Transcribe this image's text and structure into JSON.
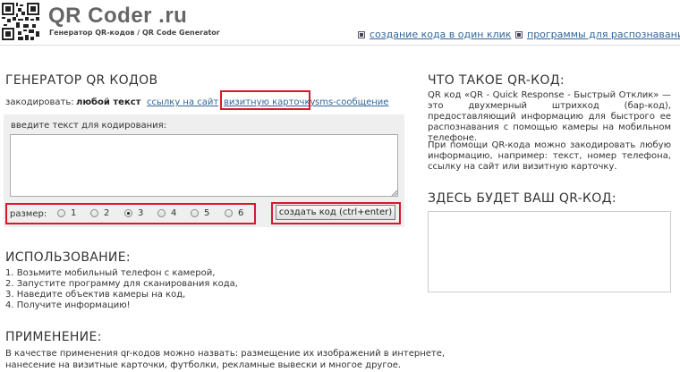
{
  "header": {
    "title": "QR Coder .ru",
    "subtitle": "Генератор QR-кодов / QR Code Generator",
    "links": [
      {
        "label": "создание кода в один клик"
      },
      {
        "label": "программы для распознавания"
      }
    ]
  },
  "generator": {
    "title": "ГЕНЕРАТОР QR КОДОВ",
    "encode_label": "закодировать:",
    "types": [
      {
        "label": "любой текст",
        "active": true
      },
      {
        "label": "ссылку на сайт"
      },
      {
        "label": "визитную карточку"
      },
      {
        "label": "sms-сообщение"
      }
    ],
    "text_label": "введите текст для кодирования:",
    "text_value": "",
    "size_label": "размер:",
    "sizes": [
      "1",
      "2",
      "3",
      "4",
      "5",
      "6"
    ],
    "selected_size": "3",
    "submit_label": "создать код (ctrl+enter)"
  },
  "usage": {
    "title": "ИСПОЛЬЗОВАНИЕ:",
    "steps": [
      "1. Возьмите мобильный телефон с камерой,",
      "2. Запустите программу для сканирования кода,",
      "3. Наведите объектив камеры на код,",
      "4. Получите информацию!"
    ]
  },
  "application": {
    "title": "ПРИМЕНЕНИЕ:",
    "lines": [
      "В качестве применения qr-кодов можно назвать: размещение их изображений в интернете,",
      "нанесение на визитные карточки, футболки, рекламные вывески и многое другое."
    ]
  },
  "about": {
    "title": "ЧТО ТАКОЕ QR-КОД:",
    "para1": "QR код «QR - Quick Response - Быстрый Отклик» — это двухмерный штрихкод (бар-код), предоставляющий информацию для быстрого ее распознавания с помощью камеры на мобильном телефоне.",
    "para2": "При помощи QR-кода можно закодировать любую информацию, например: текст, номер телефона, ссылку на сайт или визитную карточку."
  },
  "result": {
    "title": "ЗДЕСЬ БУДЕТ ВАШ QR-КОД:"
  },
  "colors": {
    "link": "#336699",
    "highlight": "#d8182b",
    "panel": "#efefef"
  }
}
